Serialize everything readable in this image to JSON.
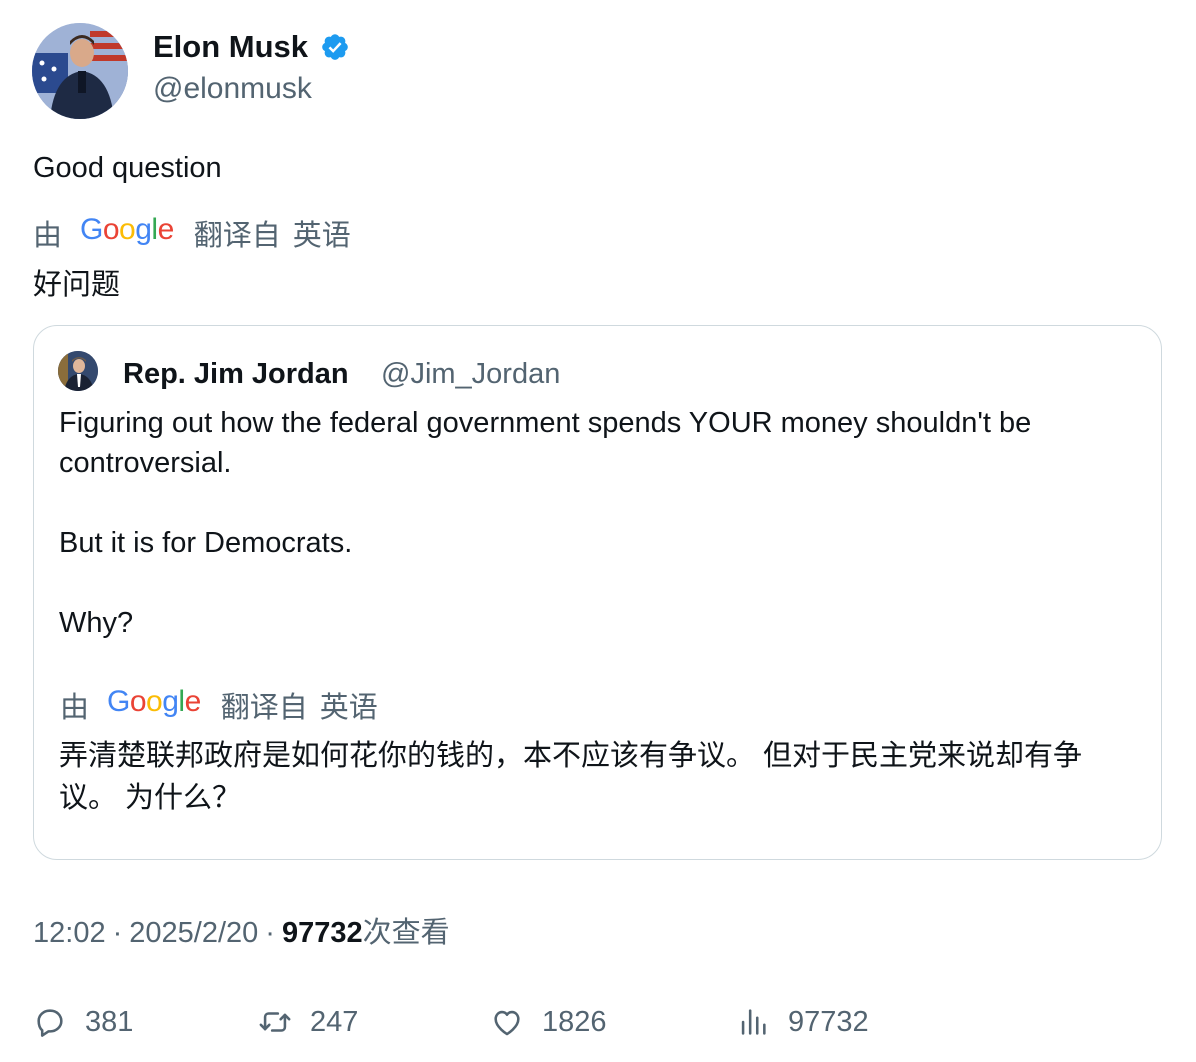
{
  "author": {
    "name": "Elon Musk",
    "handle": "@elonmusk",
    "verified": true,
    "verified_color": "#1d9bf0"
  },
  "tweet": {
    "text": "Good question",
    "translation": {
      "by": "由",
      "logo": [
        "G",
        "o",
        "o",
        "g",
        "l",
        "e"
      ],
      "from": "翻译自",
      "language": "英语",
      "text": "好问题"
    }
  },
  "quote": {
    "name": "Rep. Jim Jordan",
    "handle": "@Jim_Jordan",
    "paragraphs": [
      "Figuring out how the federal government spends YOUR money shouldn't be controversial.",
      "But it is for Democrats.",
      "Why?"
    ],
    "translation": {
      "by": "由",
      "from": "翻译自",
      "language": "英语",
      "text": "弄清楚联邦政府是如何花你的钱的，本不应该有争议。 但对于民主党来说却有争议。 为什么？"
    }
  },
  "meta": {
    "time": "12:02",
    "date": "2025/2/20",
    "separator": "·",
    "views": "97732",
    "views_label": "次查看"
  },
  "actions": {
    "replies": "381",
    "reposts": "247",
    "likes": "1826",
    "views": "97732"
  },
  "colors": {
    "text": "#0f1419",
    "secondary": "#536471",
    "border": "#cfd9de",
    "verified": "#1d9bf0"
  }
}
